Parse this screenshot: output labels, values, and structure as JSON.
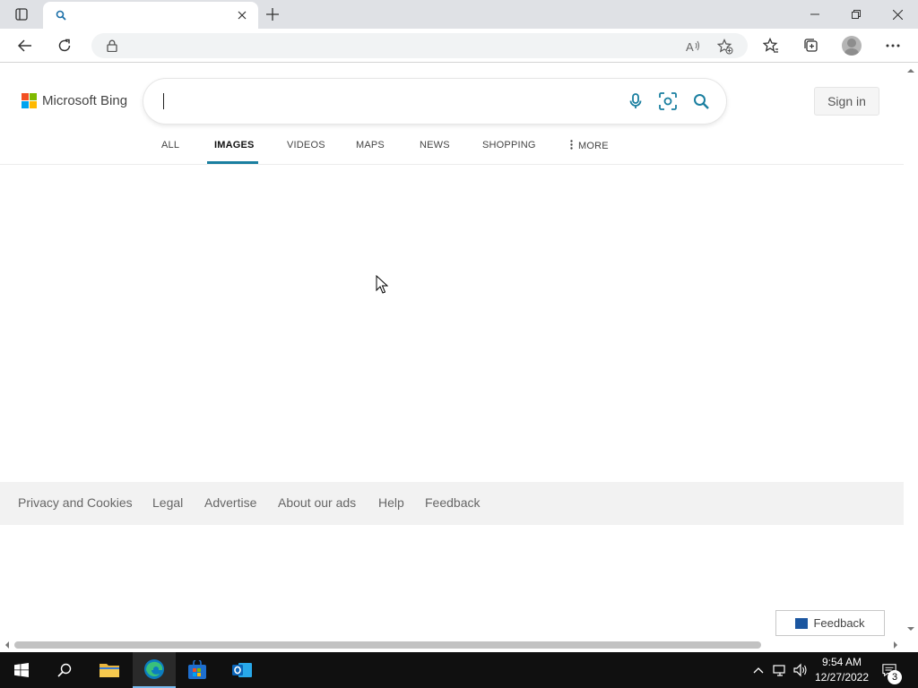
{
  "browser": {
    "tab_title": "",
    "url": ""
  },
  "bing": {
    "logo_text": "Microsoft Bing",
    "search_query": "",
    "sign_in_label": "Sign in",
    "nav_items": [
      "ALL",
      "IMAGES",
      "VIDEOS",
      "MAPS",
      "NEWS",
      "SHOPPING",
      "MORE"
    ],
    "active_nav": "IMAGES",
    "notice_line1": "",
    "notice_line2": ""
  },
  "footer": {
    "links": [
      "Privacy and Cookies",
      "Legal",
      "Advertise",
      "About our ads",
      "Help",
      "Feedback"
    ],
    "feedback_button": "Feedback"
  },
  "taskbar": {
    "time": "9:54 AM",
    "date": "12/27/2022",
    "notification_count": "3"
  },
  "colors": {
    "bing_accent": "#1a7fa0",
    "ms_red": "#f25022",
    "ms_green": "#7fba00",
    "ms_blue": "#00a4ef",
    "ms_yellow": "#ffb900",
    "taskbar_bg": "#101010"
  }
}
